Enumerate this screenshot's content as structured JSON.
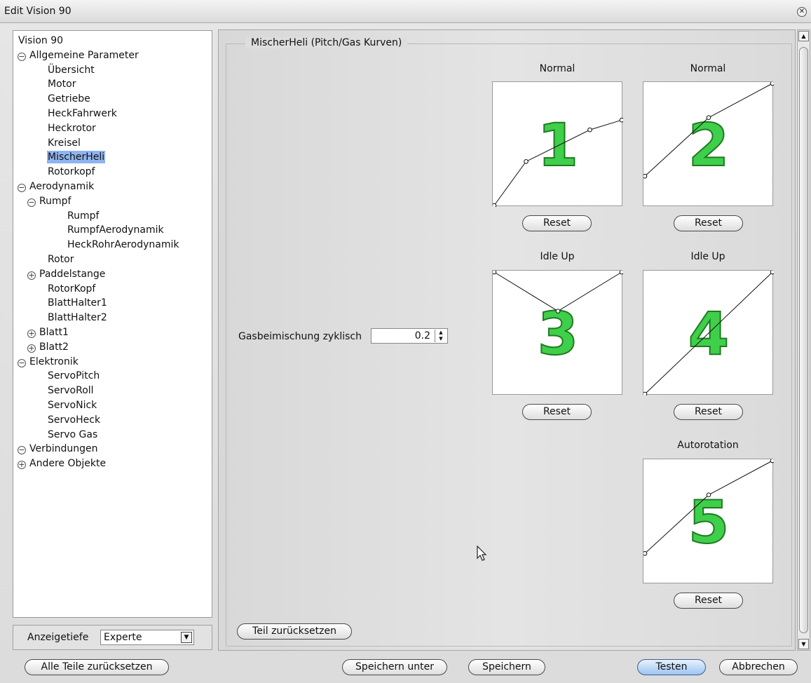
{
  "window": {
    "title": "Edit Vision 90",
    "close_glyph": "✕"
  },
  "tree": [
    {
      "label": "Vision 90",
      "indent": 0,
      "expander": ""
    },
    {
      "label": "Allgemeine Parameter",
      "indent": 0,
      "expander": "−"
    },
    {
      "label": "Übersicht",
      "indent": 2,
      "expander": ""
    },
    {
      "label": "Motor",
      "indent": 2,
      "expander": ""
    },
    {
      "label": "Getriebe",
      "indent": 2,
      "expander": ""
    },
    {
      "label": "HeckFahrwerk",
      "indent": 2,
      "expander": ""
    },
    {
      "label": "Heckrotor",
      "indent": 2,
      "expander": ""
    },
    {
      "label": "Kreisel",
      "indent": 2,
      "expander": ""
    },
    {
      "label": "MischerHeli",
      "indent": 2,
      "expander": "",
      "selected": true
    },
    {
      "label": "Rotorkopf",
      "indent": 2,
      "expander": ""
    },
    {
      "label": "Aerodynamik",
      "indent": 0,
      "expander": "−"
    },
    {
      "label": "Rumpf",
      "indent": 1,
      "expander": "−"
    },
    {
      "label": "Rumpf",
      "indent": 3,
      "expander": ""
    },
    {
      "label": "RumpfAerodynamik",
      "indent": 3,
      "expander": ""
    },
    {
      "label": "HeckRohrAerodynamik",
      "indent": 3,
      "expander": ""
    },
    {
      "label": "Rotor",
      "indent": 2,
      "expander": ""
    },
    {
      "label": "Paddelstange",
      "indent": 1,
      "expander": "+"
    },
    {
      "label": "RotorKopf",
      "indent": 2,
      "expander": ""
    },
    {
      "label": "BlattHalter1",
      "indent": 2,
      "expander": ""
    },
    {
      "label": "BlattHalter2",
      "indent": 2,
      "expander": ""
    },
    {
      "label": "Blatt1",
      "indent": 1,
      "expander": "+"
    },
    {
      "label": "Blatt2",
      "indent": 1,
      "expander": "+"
    },
    {
      "label": "Elektronik",
      "indent": 0,
      "expander": "−"
    },
    {
      "label": "ServoPitch",
      "indent": 2,
      "expander": ""
    },
    {
      "label": "ServoRoll",
      "indent": 2,
      "expander": ""
    },
    {
      "label": "ServoNick",
      "indent": 2,
      "expander": ""
    },
    {
      "label": "ServoHeck",
      "indent": 2,
      "expander": ""
    },
    {
      "label": "Servo Gas",
      "indent": 2,
      "expander": ""
    },
    {
      "label": "Verbindungen",
      "indent": 0,
      "expander": "−"
    },
    {
      "label": "Andere Objekte",
      "indent": 0,
      "expander": "+"
    }
  ],
  "depth": {
    "label": "Anzeigetiefe",
    "value": "Experte",
    "arrow": "▼"
  },
  "panel": {
    "group_title": "MischerHeli (Pitch/Gas Kurven)",
    "gas_label": "Gasbeimischung zyklisch",
    "gas_value": "0.2",
    "spin_up": "▲",
    "spin_down": "▼",
    "reset_part_label": "Teil zurücksetzen"
  },
  "curves": [
    {
      "id": "1",
      "title": "Normal",
      "reset_label": "Reset",
      "points": [
        [
          0,
          0
        ],
        [
          0.25,
          0.36
        ],
        [
          0.75,
          0.62
        ],
        [
          1,
          0.7
        ]
      ]
    },
    {
      "id": "2",
      "title": "Normal",
      "reset_label": "Reset",
      "points": [
        [
          0,
          0.24
        ],
        [
          0.5,
          0.72
        ],
        [
          1,
          1
        ]
      ]
    },
    {
      "id": "3",
      "title": "Idle Up",
      "reset_label": "Reset",
      "points": [
        [
          0,
          1
        ],
        [
          0.5,
          0.68
        ],
        [
          1,
          1
        ]
      ]
    },
    {
      "id": "4",
      "title": "Idle Up",
      "reset_label": "Reset",
      "points": [
        [
          0,
          0
        ],
        [
          1,
          1
        ]
      ]
    },
    {
      "id": "5",
      "title": "Autorotation",
      "reset_label": "Reset",
      "points": [
        [
          0,
          0.24
        ],
        [
          0.5,
          0.72
        ],
        [
          1,
          1
        ]
      ]
    }
  ],
  "curve_style": {
    "number_fill": "#3fcf4a",
    "number_stroke": "#1f7a22"
  },
  "footer": {
    "reset_all_label": "Alle Teile zurücksetzen",
    "save_as_label": "Speichern unter",
    "save_label": "Speichern",
    "test_label": "Testen",
    "cancel_label": "Abbrechen"
  },
  "scrollbar": {
    "up": "▲",
    "down": "▼"
  }
}
